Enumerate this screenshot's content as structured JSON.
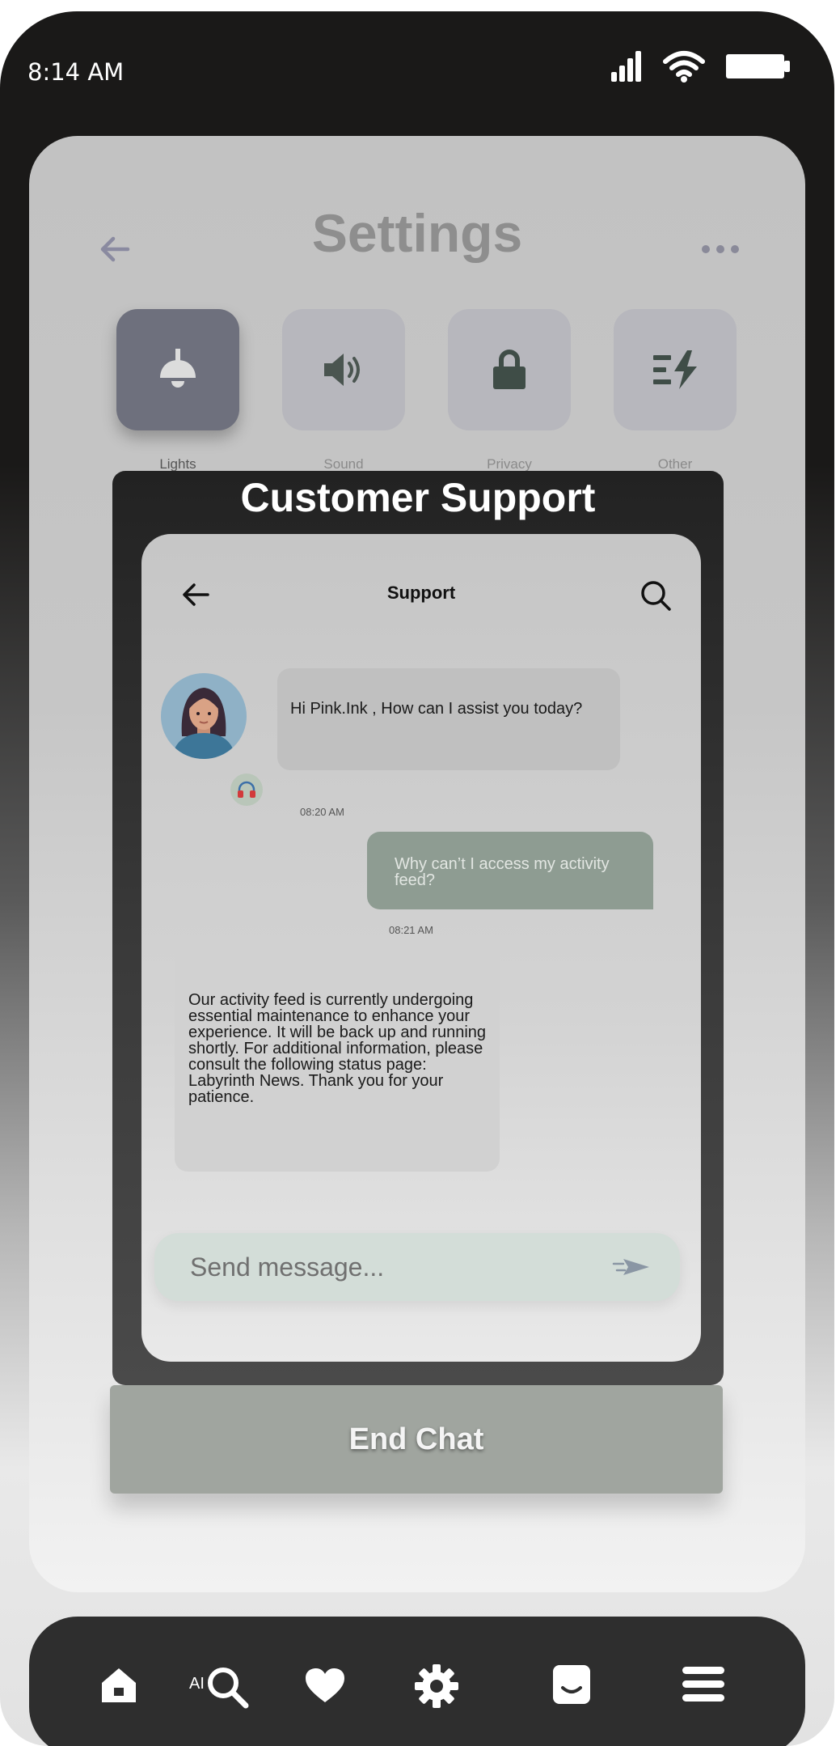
{
  "status_bar": {
    "time": "8:14 AM"
  },
  "settings": {
    "title": "Settings",
    "categories": [
      {
        "label": "Lights",
        "icon": "lamp-icon",
        "active": true
      },
      {
        "label": "Sound",
        "icon": "speaker-icon",
        "active": false
      },
      {
        "label": "Privacy",
        "icon": "lock-icon",
        "active": false
      },
      {
        "label": "Other",
        "icon": "lines-bolt-icon",
        "active": false
      }
    ]
  },
  "support_panel": {
    "heading": "Customer Support",
    "chat": {
      "title": "Support",
      "messages": [
        {
          "from": "agent",
          "text": "Hi Pink.Ink , How can I assist you today?",
          "time": "08:20 AM"
        },
        {
          "from": "user",
          "text": "Why can’t I access my activity feed?",
          "time": "08:21 AM"
        },
        {
          "from": "agent",
          "text": "Our activity feed is currently undergoing essential maintenance to enhance your experience. It will be back up and running shortly. For additional information, please consult the following status page: Labyrinth News. Thank you for your patience."
        }
      ],
      "input": {
        "placeholder": "Send message..."
      }
    }
  },
  "end_chat": {
    "label": "End Chat"
  },
  "tab_bar": {
    "ai_label": "AI",
    "items": [
      "home-icon",
      "ai-search-icon",
      "heart-icon",
      "gear-icon",
      "smile-square-icon",
      "menu-icon"
    ]
  },
  "colors": {
    "active_tile": "#6e707d",
    "user_bubble": "#8e9c92",
    "end_chat_button": "#a0a59f",
    "tab_bar": "#2e2e2e"
  }
}
